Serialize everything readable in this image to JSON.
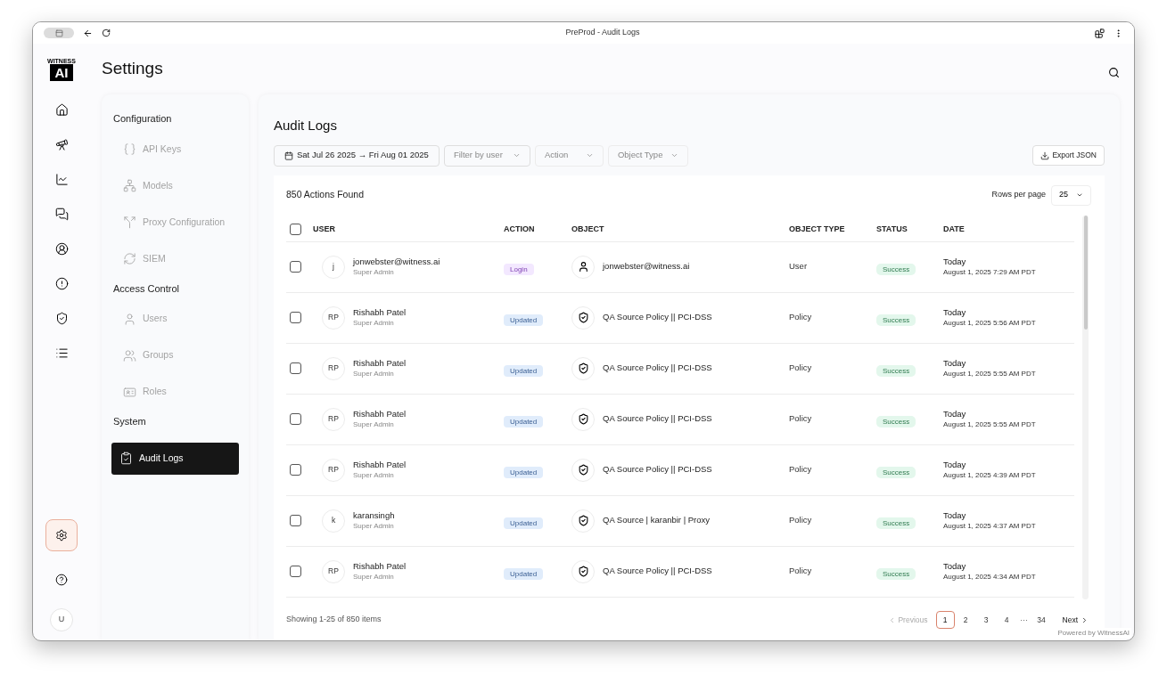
{
  "window": {
    "title": "PreProd - Audit Logs"
  },
  "logo": {
    "small": "WITNESS",
    "big": "AI"
  },
  "rail": [
    {
      "kind": "home",
      "selected": false
    },
    {
      "kind": "telescope",
      "selected": false
    },
    {
      "kind": "chart",
      "selected": false
    },
    {
      "kind": "chat",
      "selected": false
    },
    {
      "kind": "user",
      "selected": false
    },
    {
      "kind": "alert",
      "selected": false
    },
    {
      "kind": "shield",
      "selected": false
    },
    {
      "kind": "list",
      "selected": false
    }
  ],
  "rail_bottom": [
    {
      "kind": "settings",
      "selected": true
    },
    {
      "kind": "help",
      "selected": false
    }
  ],
  "profile": {
    "initial": "U"
  },
  "page_title": "Settings",
  "settings_nav": [
    {
      "heading": "Configuration",
      "items": [
        {
          "label": "API Keys",
          "selected": false
        },
        {
          "label": "Models",
          "selected": false
        },
        {
          "label": "Proxy Configuration",
          "selected": false
        },
        {
          "label": "SIEM",
          "selected": false
        }
      ]
    },
    {
      "heading": "Access Control",
      "items": [
        {
          "label": "Users",
          "selected": false
        },
        {
          "label": "Groups",
          "selected": false
        },
        {
          "label": "Roles",
          "selected": false
        }
      ]
    },
    {
      "heading": "System",
      "items": [
        {
          "label": "Audit Logs",
          "selected": true
        }
      ]
    }
  ],
  "panel": {
    "title": "Audit Logs",
    "date_range": "Sat Jul 26 2025 → Fri Aug 01 2025",
    "filters": [
      {
        "placeholder": "Filter by user"
      },
      {
        "placeholder": "Action"
      },
      {
        "placeholder": "Object Type"
      }
    ],
    "export": "Export JSON",
    "count": "850 Actions Found",
    "rows_per_page_label": "Rows per page",
    "rows_per_page": "25"
  },
  "table": {
    "all_selected": false,
    "columns": [
      "USER",
      "ACTION",
      "OBJECT",
      "OBJECT TYPE",
      "STATUS",
      "DATE"
    ],
    "rows": [
      {
        "selected": false,
        "initials": "j",
        "user": "jonwebster@witness.ai",
        "role": "Super Admin",
        "action": {
          "label": "Login",
          "kind": "login"
        },
        "object": {
          "label": "jonwebster@witness.ai",
          "kind": "user"
        },
        "object_type": "User",
        "status": "Success",
        "day": "Today",
        "date": "August 1, 2025 7:29 AM PDT"
      },
      {
        "selected": false,
        "initials": "RP",
        "user": "Rishabh Patel",
        "role": "Super Admin",
        "action": {
          "label": "Updated",
          "kind": "updated"
        },
        "object": {
          "label": "QA Source Policy || PCI-DSS",
          "kind": "policy"
        },
        "object_type": "Policy",
        "status": "Success",
        "day": "Today",
        "date": "August 1, 2025 5:56 AM PDT"
      },
      {
        "selected": false,
        "initials": "RP",
        "user": "Rishabh Patel",
        "role": "Super Admin",
        "action": {
          "label": "Updated",
          "kind": "updated"
        },
        "object": {
          "label": "QA Source Policy || PCI-DSS",
          "kind": "policy"
        },
        "object_type": "Policy",
        "status": "Success",
        "day": "Today",
        "date": "August 1, 2025 5:55 AM PDT"
      },
      {
        "selected": false,
        "initials": "RP",
        "user": "Rishabh Patel",
        "role": "Super Admin",
        "action": {
          "label": "Updated",
          "kind": "updated"
        },
        "object": {
          "label": "QA Source Policy || PCI-DSS",
          "kind": "policy"
        },
        "object_type": "Policy",
        "status": "Success",
        "day": "Today",
        "date": "August 1, 2025 5:55 AM PDT"
      },
      {
        "selected": false,
        "initials": "RP",
        "user": "Rishabh Patel",
        "role": "Super Admin",
        "action": {
          "label": "Updated",
          "kind": "updated"
        },
        "object": {
          "label": "QA Source Policy || PCI-DSS",
          "kind": "policy"
        },
        "object_type": "Policy",
        "status": "Success",
        "day": "Today",
        "date": "August 1, 2025 4:39 AM PDT"
      },
      {
        "selected": false,
        "initials": "k",
        "user": "karansingh",
        "role": "Super Admin",
        "action": {
          "label": "Updated",
          "kind": "updated"
        },
        "object": {
          "label": "QA Source | karanbir | Proxy",
          "kind": "policy"
        },
        "object_type": "Policy",
        "status": "Success",
        "day": "Today",
        "date": "August 1, 2025 4:37 AM PDT"
      },
      {
        "selected": false,
        "initials": "RP",
        "user": "Rishabh Patel",
        "role": "Super Admin",
        "action": {
          "label": "Updated",
          "kind": "updated"
        },
        "object": {
          "label": "QA Source Policy || PCI-DSS",
          "kind": "policy"
        },
        "object_type": "Policy",
        "status": "Success",
        "day": "Today",
        "date": "August 1, 2025 4:34 AM PDT"
      }
    ]
  },
  "pagination": {
    "summary": "Showing 1-25 of 850 items",
    "previous": {
      "label": "Previous",
      "disabled": true
    },
    "pages": [
      {
        "label": "1",
        "selected": true
      },
      {
        "label": "2",
        "selected": false
      },
      {
        "label": "3",
        "selected": false
      },
      {
        "label": "4",
        "selected": false
      }
    ],
    "gap": "···",
    "last_pages": [
      {
        "label": "34",
        "selected": false
      }
    ],
    "next": {
      "label": "Next",
      "disabled": false
    }
  },
  "footer": "Powered by WitnessAI"
}
